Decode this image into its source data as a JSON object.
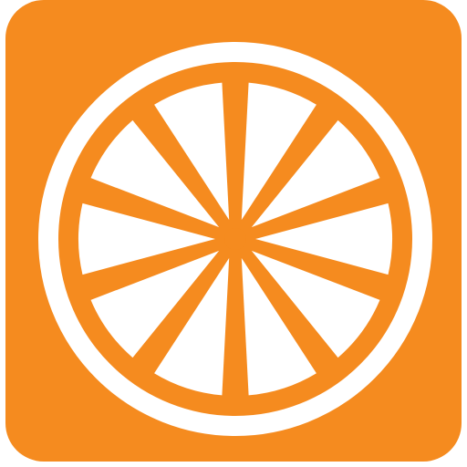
{
  "icon": {
    "name": "orange-slice-icon",
    "colors": {
      "tile_background": "#F58B1F",
      "rind_and_segments": "#FFFFFF"
    },
    "segment_count": 10
  }
}
